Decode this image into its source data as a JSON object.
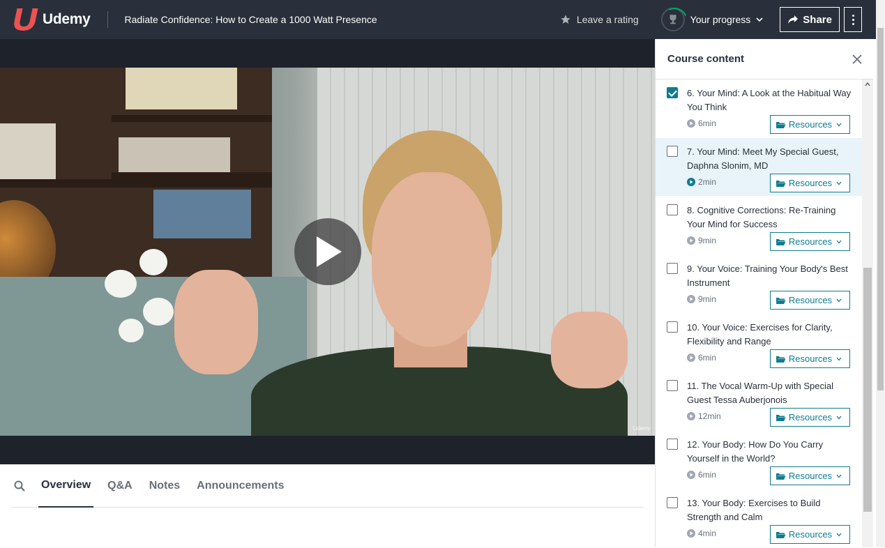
{
  "header": {
    "brand": "Udemy",
    "course_title": "Radiate Confidence: How to Create a 1000 Watt Presence",
    "leave_rating": "Leave a rating",
    "your_progress": "Your progress",
    "share": "Share"
  },
  "video": {
    "watermark": "Udemy"
  },
  "tabs": [
    {
      "label": "Overview",
      "active": true
    },
    {
      "label": "Q&A",
      "active": false
    },
    {
      "label": "Notes",
      "active": false
    },
    {
      "label": "Announcements",
      "active": false
    }
  ],
  "sidebar": {
    "title": "Course content",
    "resources_label": "Resources",
    "lectures": [
      {
        "title": "6. Your Mind: A Look at the Habitual Way You Think",
        "duration": "6min",
        "checked": true,
        "current": false
      },
      {
        "title": "7. Your Mind: Meet My Special Guest, Daphna Slonim, MD",
        "duration": "2min",
        "checked": false,
        "current": true
      },
      {
        "title": "8. Cognitive Corrections: Re-Training Your Mind for Success",
        "duration": "9min",
        "checked": false,
        "current": false
      },
      {
        "title": "9. Your Voice: Training Your Body's Best Instrument",
        "duration": "9min",
        "checked": false,
        "current": false
      },
      {
        "title": "10. Your Voice: Exercises for Clarity, Flexibility and Range",
        "duration": "6min",
        "checked": false,
        "current": false
      },
      {
        "title": "11. The Vocal Warm-Up with Special Guest Tessa Auberjonois",
        "duration": "12min",
        "checked": false,
        "current": false
      },
      {
        "title": "12. Your Body: How Do You Carry Yourself in the World?",
        "duration": "6min",
        "checked": false,
        "current": false
      },
      {
        "title": "13. Your Body: Exercises to Build Strength and Calm",
        "duration": "4min",
        "checked": false,
        "current": false
      }
    ]
  },
  "colors": {
    "header_bg": "#29303b",
    "accent": "#0f7c90",
    "brand_red": "#ec5252"
  }
}
